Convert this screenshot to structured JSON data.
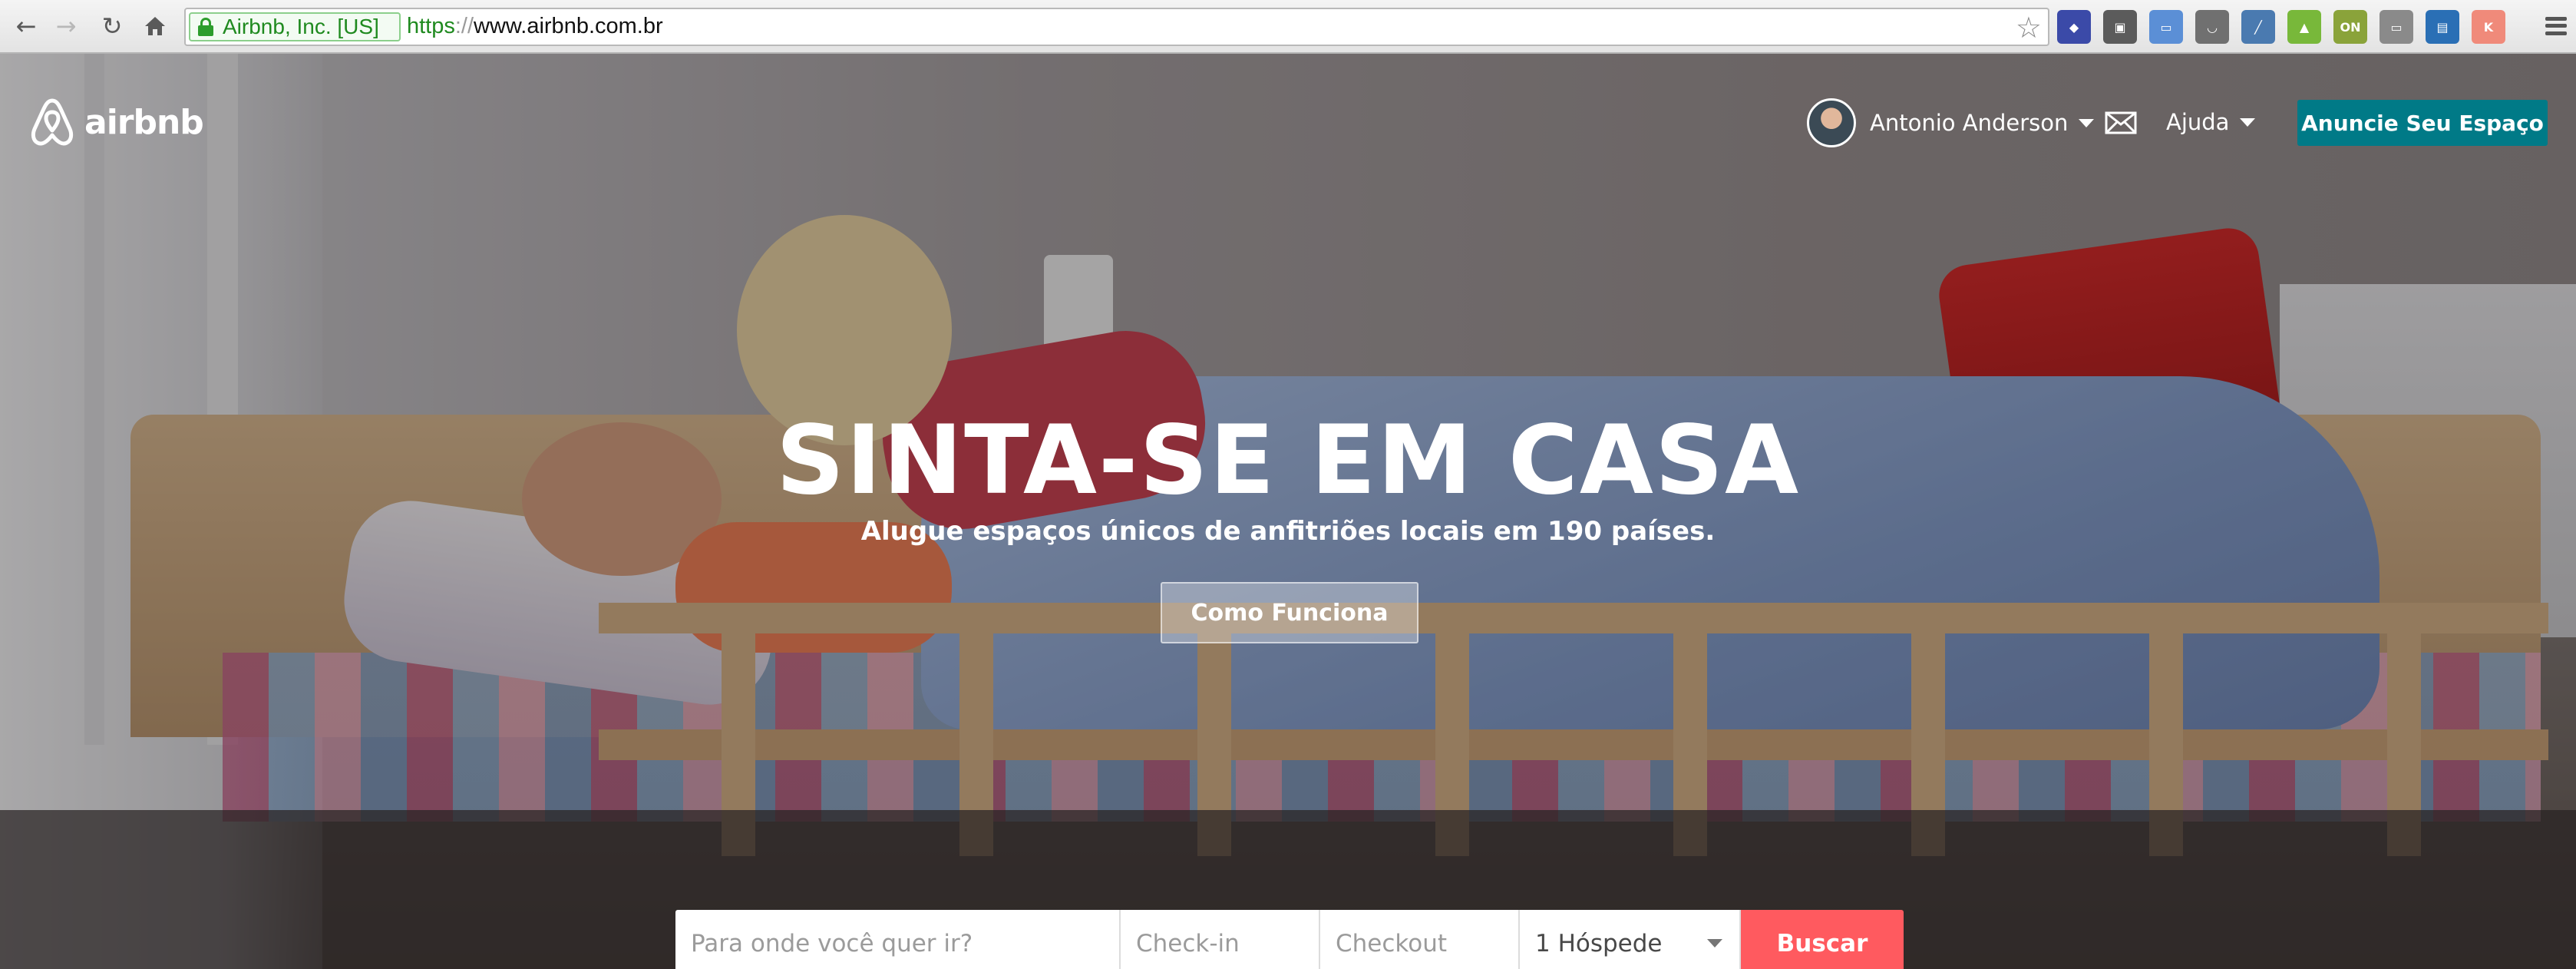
{
  "browser": {
    "back_icon": "arrow-left-icon",
    "forward_icon": "arrow-right-icon",
    "reload_icon": "reload-icon",
    "home_icon": "home-icon",
    "ev_label": "Airbnb, Inc. [US]",
    "url_scheme": "https",
    "url_separator": "://",
    "url_host": "www.airbnb.com.br",
    "bookmark_icon": "star-icon",
    "extensions": [
      {
        "name": "dragon-extension-icon",
        "color": "#3b4aa8",
        "glyph": "◆"
      },
      {
        "name": "puzzle-extension-icon",
        "color": "#5b5b5b",
        "glyph": "▣"
      },
      {
        "name": "folder-extension-icon",
        "color": "#5b8fd6",
        "glyph": "▭"
      },
      {
        "name": "pocket-extension-icon",
        "color": "#707070",
        "glyph": "◡"
      },
      {
        "name": "eyedropper-extension-icon",
        "color": "#4a7ab0",
        "glyph": "╱"
      },
      {
        "name": "android-extension-icon",
        "color": "#78b83a",
        "glyph": "▲"
      },
      {
        "name": "boxon-extension-icon",
        "color": "#8aa33a",
        "glyph": "ON"
      },
      {
        "name": "cast-extension-icon",
        "color": "#8a8a8a",
        "glyph": "▭"
      },
      {
        "name": "trello-extension-icon",
        "color": "#2a6fb5",
        "glyph": "▤"
      },
      {
        "name": "kit-extension-icon",
        "color": "#f08a7a",
        "glyph": "K"
      }
    ],
    "menu_icon": "hamburger-menu-icon"
  },
  "header": {
    "logo_text": "airbnb",
    "user_name": "Antonio Anderson",
    "help_label": "Ajuda",
    "host_button": "Anuncie Seu Espaço"
  },
  "hero": {
    "headline": "SINTA-SE EM CASA",
    "subline": "Alugue espaços únicos de anfitriões locais em 190 países.",
    "how_button": "Como Funciona"
  },
  "search": {
    "where_placeholder": "Para onde você quer ir?",
    "checkin_placeholder": "Check-in",
    "checkout_placeholder": "Checkout",
    "guests_value": "1 Hóspede",
    "submit_label": "Buscar"
  },
  "colors": {
    "brand_teal": "#007a87",
    "search_red": "#ff5a5f"
  }
}
